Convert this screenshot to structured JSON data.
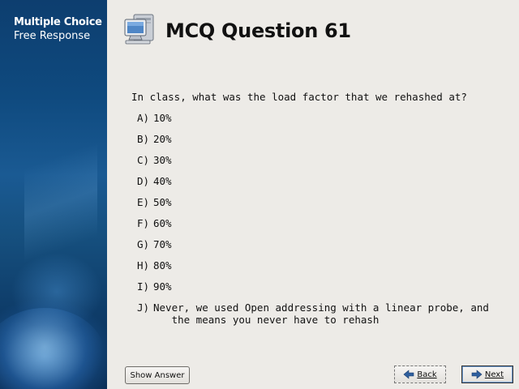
{
  "sidebar": {
    "items": [
      {
        "label": "Multiple Choice"
      },
      {
        "label": "Free Response"
      }
    ]
  },
  "header": {
    "title": "MCQ Question 61",
    "icon": "computer-icon"
  },
  "question": {
    "text": "In class, what was the load factor that we rehashed at?",
    "options": [
      {
        "letter": "A)",
        "text": "10%"
      },
      {
        "letter": "B)",
        "text": "20%"
      },
      {
        "letter": "C)",
        "text": "30%"
      },
      {
        "letter": "D)",
        "text": "40%"
      },
      {
        "letter": "E)",
        "text": "50%"
      },
      {
        "letter": "F)",
        "text": "60%"
      },
      {
        "letter": "G)",
        "text": "70%"
      },
      {
        "letter": "H)",
        "text": "80%"
      },
      {
        "letter": "I)",
        "text": "90%"
      },
      {
        "letter": "J)",
        "text": "Never, we used Open addressing with a linear probe, and\n   the means you never have to rehash"
      }
    ]
  },
  "footer": {
    "show_answer_label": "Show Answer",
    "back_label": "Back",
    "next_label": "Next"
  },
  "colors": {
    "sidebar_bg": "#0f4a7f",
    "page_bg": "#edebe7",
    "arrow_blue": "#2f5f9e"
  }
}
